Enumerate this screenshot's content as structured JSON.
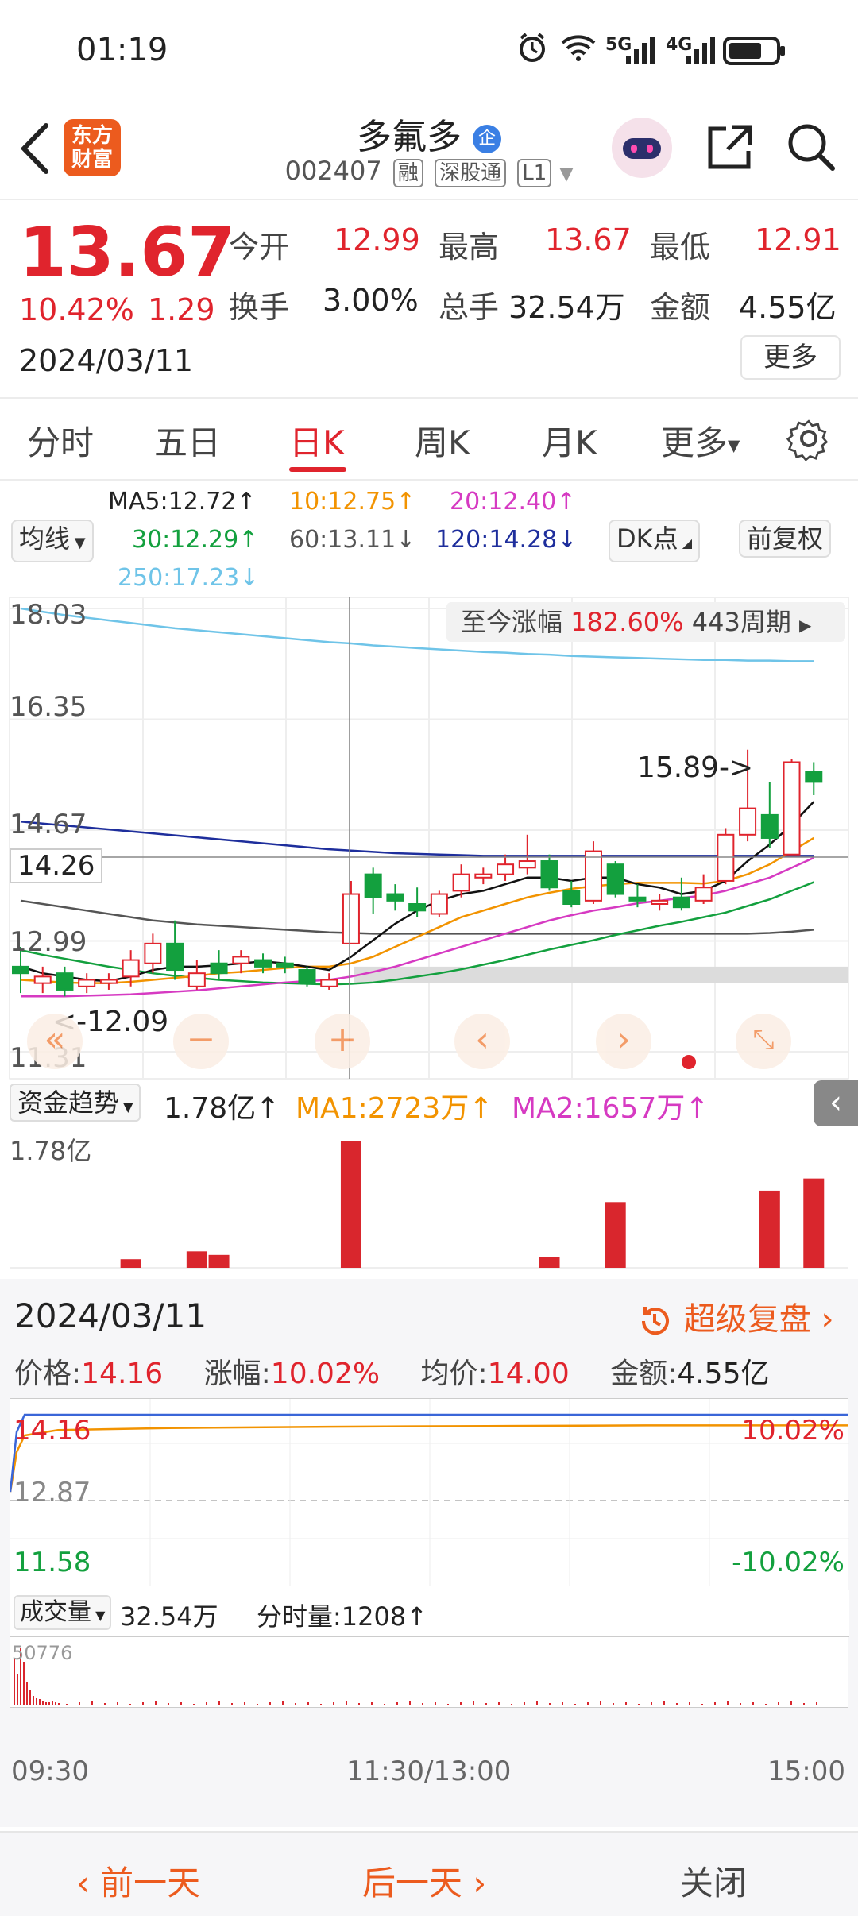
{
  "status_bar": {
    "time": "01:19",
    "net1": "5G",
    "net2": "4G"
  },
  "header": {
    "logo_line1": "东方",
    "logo_line2": "财富",
    "stock_name": "多氟多",
    "badge": "企",
    "code": "002407",
    "tags": [
      "融",
      "深股通",
      "L1"
    ]
  },
  "quote": {
    "price": "13.67",
    "change_pct": "10.42%",
    "change_amt": "1.29",
    "date": "2024/03/11",
    "open_label": "今开",
    "open": "12.99",
    "high_label": "最高",
    "high": "13.67",
    "low_label": "最低",
    "low": "12.91",
    "turnover_label": "换手",
    "turnover": "3.00%",
    "volume_label": "总手",
    "volume": "32.54万",
    "amount_label": "金额",
    "amount": "4.55亿",
    "more_label": "更多"
  },
  "tabs": [
    "分时",
    "五日",
    "日K",
    "周K",
    "月K",
    "更多"
  ],
  "active_tab": "日K",
  "indicator_select": "均线",
  "ma_legend": {
    "ma5": "MA5:12.72↑",
    "ma10": "10:12.75↑",
    "ma20": "20:12.40↑",
    "ma30": "30:12.29↑",
    "ma60": "60:13.11↓",
    "ma120": "120:14.28↓",
    "ma250": "250:17.23↓"
  },
  "dk_label": "DK点",
  "fq_label": "前复权",
  "kline": {
    "y_labels": [
      "18.03",
      "16.35",
      "14.67",
      "12.99",
      "11.31"
    ],
    "crosshair_price": "14.26",
    "gain_label": "至今涨幅",
    "gain_value": "182.60%",
    "period": "443周期",
    "high_annot": "15.89->",
    "low_annot": "<-12.09"
  },
  "fund": {
    "select": "资金趋势",
    "value": "1.78亿↑",
    "ma1": "MA1:2723万↑",
    "ma2": "MA2:1657万↑",
    "axis_label": "1.78亿"
  },
  "panel": {
    "date": "2024/03/11",
    "replay_label": "超级复盘",
    "price_label": "价格:",
    "price": "14.16",
    "pct_label": "涨幅:",
    "pct": "10.02%",
    "avg_label": "均价:",
    "avg": "14.00",
    "amt_label": "金额:",
    "amt": "4.55亿",
    "y_top": "14.16",
    "y_mid": "12.87",
    "y_bot": "11.58",
    "pct_top": "10.02%",
    "pct_bot": "-10.02%",
    "vol_select": "成交量",
    "vol_value": "32.54万",
    "tick_vol": "分时量:1208↑",
    "vol_axis": "50776",
    "times": [
      "09:30",
      "11:30/13:00",
      "15:00"
    ]
  },
  "footer": {
    "prev": "前一天",
    "next": "后一天",
    "close": "关闭"
  },
  "chart_data": {
    "type": "candlestick",
    "y_range": [
      11.31,
      18.03
    ],
    "candles": [
      {
        "o": 12.6,
        "c": 12.5,
        "h": 12.9,
        "l": 12.2,
        "dir": "down"
      },
      {
        "o": 12.45,
        "c": 12.35,
        "h": 12.6,
        "l": 12.2,
        "dir": "up"
      },
      {
        "o": 12.5,
        "c": 12.25,
        "h": 12.6,
        "l": 12.15,
        "dir": "down"
      },
      {
        "o": 12.3,
        "c": 12.4,
        "h": 12.5,
        "l": 12.2,
        "dir": "up"
      },
      {
        "o": 12.35,
        "c": 12.4,
        "h": 12.5,
        "l": 12.25,
        "dir": "up"
      },
      {
        "o": 12.45,
        "c": 12.7,
        "h": 12.85,
        "l": 12.3,
        "dir": "up"
      },
      {
        "o": 12.65,
        "c": 12.95,
        "h": 13.1,
        "l": 12.5,
        "dir": "up"
      },
      {
        "o": 12.95,
        "c": 12.55,
        "h": 13.3,
        "l": 12.4,
        "dir": "down"
      },
      {
        "o": 12.5,
        "c": 12.3,
        "h": 12.7,
        "l": 12.25,
        "dir": "up"
      },
      {
        "o": 12.5,
        "c": 12.65,
        "h": 12.85,
        "l": 12.4,
        "dir": "down"
      },
      {
        "o": 12.65,
        "c": 12.75,
        "h": 12.85,
        "l": 12.5,
        "dir": "up"
      },
      {
        "o": 12.7,
        "c": 12.6,
        "h": 12.8,
        "l": 12.5,
        "dir": "down"
      },
      {
        "o": 12.65,
        "c": 12.6,
        "h": 12.75,
        "l": 12.5,
        "dir": "down"
      },
      {
        "o": 12.55,
        "c": 12.35,
        "h": 12.6,
        "l": 12.3,
        "dir": "down"
      },
      {
        "o": 12.3,
        "c": 12.4,
        "h": 12.5,
        "l": 12.25,
        "dir": "up"
      },
      {
        "o": 12.95,
        "c": 13.7,
        "h": 13.9,
        "l": 12.95,
        "dir": "up"
      },
      {
        "o": 14.0,
        "c": 13.65,
        "h": 14.1,
        "l": 13.4,
        "dir": "down"
      },
      {
        "o": 13.7,
        "c": 13.6,
        "h": 13.85,
        "l": 13.45,
        "dir": "down"
      },
      {
        "o": 13.55,
        "c": 13.45,
        "h": 13.8,
        "l": 13.35,
        "dir": "down"
      },
      {
        "o": 13.4,
        "c": 13.7,
        "h": 13.75,
        "l": 13.35,
        "dir": "up"
      },
      {
        "o": 13.75,
        "c": 14.0,
        "h": 14.15,
        "l": 13.65,
        "dir": "up"
      },
      {
        "o": 13.95,
        "c": 14.0,
        "h": 14.1,
        "l": 13.85,
        "dir": "up"
      },
      {
        "o": 14.0,
        "c": 14.15,
        "h": 14.3,
        "l": 13.9,
        "dir": "up"
      },
      {
        "o": 14.1,
        "c": 14.2,
        "h": 14.6,
        "l": 14.0,
        "dir": "up"
      },
      {
        "o": 14.2,
        "c": 13.8,
        "h": 14.3,
        "l": 13.75,
        "dir": "down"
      },
      {
        "o": 13.75,
        "c": 13.55,
        "h": 13.9,
        "l": 13.5,
        "dir": "down"
      },
      {
        "o": 13.6,
        "c": 14.35,
        "h": 14.5,
        "l": 13.55,
        "dir": "up"
      },
      {
        "o": 14.15,
        "c": 13.7,
        "h": 14.2,
        "l": 13.65,
        "dir": "down"
      },
      {
        "o": 13.65,
        "c": 13.6,
        "h": 13.85,
        "l": 13.5,
        "dir": "down"
      },
      {
        "o": 13.55,
        "c": 13.6,
        "h": 13.7,
        "l": 13.45,
        "dir": "up"
      },
      {
        "o": 13.65,
        "c": 13.5,
        "h": 13.95,
        "l": 13.45,
        "dir": "down"
      },
      {
        "o": 13.6,
        "c": 13.8,
        "h": 14.0,
        "l": 13.55,
        "dir": "up"
      },
      {
        "o": 13.9,
        "c": 14.6,
        "h": 14.7,
        "l": 13.85,
        "dir": "up"
      },
      {
        "o": 14.6,
        "c": 15.0,
        "h": 15.89,
        "l": 14.5,
        "dir": "up"
      },
      {
        "o": 14.9,
        "c": 14.55,
        "h": 15.4,
        "l": 14.4,
        "dir": "down"
      },
      {
        "o": 14.3,
        "c": 15.7,
        "h": 15.75,
        "l": 14.3,
        "dir": "up"
      },
      {
        "o": 15.55,
        "c": 15.4,
        "h": 15.7,
        "l": 15.2,
        "dir": "down"
      }
    ],
    "ma5": [
      12.6,
      12.5,
      12.45,
      12.4,
      12.38,
      12.45,
      12.55,
      12.6,
      12.6,
      12.62,
      12.65,
      12.68,
      12.65,
      12.6,
      12.55,
      12.75,
      13.0,
      13.25,
      13.45,
      13.6,
      13.7,
      13.75,
      13.85,
      13.95,
      13.95,
      13.9,
      13.95,
      13.95,
      13.85,
      13.8,
      13.7,
      13.75,
      13.9,
      14.2,
      14.45,
      14.75,
      15.1
    ],
    "ma10": [
      12.4,
      12.38,
      12.36,
      12.35,
      12.35,
      12.37,
      12.4,
      12.43,
      12.46,
      12.5,
      12.52,
      12.55,
      12.58,
      12.6,
      12.6,
      12.65,
      12.75,
      12.9,
      13.05,
      13.2,
      13.35,
      13.45,
      13.55,
      13.65,
      13.72,
      13.78,
      13.82,
      13.85,
      13.87,
      13.87,
      13.87,
      13.86,
      13.9,
      14.0,
      14.15,
      14.35,
      14.55
    ],
    "ma20": [
      12.15,
      12.15,
      12.15,
      12.16,
      12.17,
      12.18,
      12.2,
      12.22,
      12.24,
      12.27,
      12.3,
      12.33,
      12.36,
      12.38,
      12.4,
      12.45,
      12.52,
      12.6,
      12.7,
      12.8,
      12.9,
      13.0,
      13.1,
      13.2,
      13.3,
      13.38,
      13.45,
      13.5,
      13.56,
      13.6,
      13.64,
      13.68,
      13.75,
      13.85,
      13.95,
      14.1,
      14.25
    ],
    "ma30": [
      12.85,
      12.78,
      12.72,
      12.66,
      12.6,
      12.55,
      12.5,
      12.46,
      12.43,
      12.4,
      12.38,
      12.36,
      12.35,
      12.34,
      12.33,
      12.34,
      12.36,
      12.4,
      12.45,
      12.5,
      12.56,
      12.63,
      12.7,
      12.78,
      12.86,
      12.93,
      13.0,
      13.08,
      13.15,
      13.22,
      13.28,
      13.35,
      13.42,
      13.52,
      13.62,
      13.75,
      13.88
    ],
    "ma60": [
      13.6,
      13.55,
      13.5,
      13.45,
      13.4,
      13.35,
      13.3,
      13.27,
      13.24,
      13.22,
      13.2,
      13.18,
      13.16,
      13.14,
      13.12,
      13.11,
      13.1,
      13.1,
      13.1,
      13.1,
      13.1,
      13.1,
      13.1,
      13.1,
      13.1,
      13.1,
      13.1,
      13.1,
      13.1,
      13.1,
      13.1,
      13.1,
      13.1,
      13.1,
      13.11,
      13.13,
      13.16
    ],
    "ma120": [
      14.8,
      14.77,
      14.74,
      14.71,
      14.68,
      14.65,
      14.62,
      14.59,
      14.56,
      14.53,
      14.5,
      14.47,
      14.44,
      14.41,
      14.38,
      14.36,
      14.34,
      14.32,
      14.31,
      14.3,
      14.29,
      14.28,
      14.28,
      14.28,
      14.28,
      14.28,
      14.28,
      14.28,
      14.28,
      14.28,
      14.28,
      14.28,
      14.28,
      14.28,
      14.28,
      14.28,
      14.28
    ],
    "ma250": [
      18.03,
      17.98,
      17.93,
      17.89,
      17.85,
      17.81,
      17.77,
      17.73,
      17.7,
      17.67,
      17.64,
      17.61,
      17.58,
      17.55,
      17.52,
      17.5,
      17.47,
      17.45,
      17.43,
      17.41,
      17.39,
      17.37,
      17.36,
      17.34,
      17.33,
      17.31,
      17.3,
      17.29,
      17.28,
      17.27,
      17.26,
      17.25,
      17.25,
      17.24,
      17.24,
      17.23,
      17.23
    ],
    "fund_bars": {
      "max": 1.78,
      "values": [
        0,
        0,
        0,
        0,
        0,
        0.12,
        0,
        0,
        0.23,
        0.18,
        0,
        0,
        0,
        0,
        0,
        1.78,
        0,
        0,
        0,
        0,
        0,
        0,
        0,
        0,
        0.15,
        0,
        0,
        0.92,
        0,
        0,
        0,
        0,
        0,
        0,
        1.08,
        0,
        1.25
      ]
    },
    "intraday": {
      "type": "line",
      "y_range": [
        11.58,
        14.16
      ],
      "price": [
        13.0,
        13.9,
        14.16,
        14.16,
        14.16,
        14.16,
        14.16,
        14.16,
        14.16
      ],
      "avg": [
        13.0,
        13.6,
        13.85,
        13.93,
        13.96,
        13.98,
        13.99,
        14.0,
        14.0
      ]
    }
  }
}
